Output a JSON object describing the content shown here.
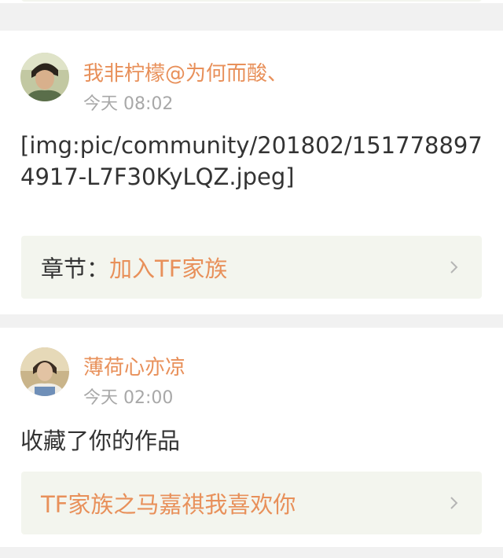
{
  "posts": [
    {
      "username": "我非柠檬@为何而酸、",
      "time": "今天 08:02",
      "content": "[img:pic/community/201802/1517788974917-L7F30KyLQZ.jpeg]",
      "link": {
        "label": "章节：",
        "title": "加入TF家族"
      }
    },
    {
      "username": "薄荷心亦凉",
      "time": "今天 02:00",
      "content": "收藏了你的作品",
      "link": {
        "title": "TF家族之马嘉祺我喜欢你"
      }
    }
  ],
  "icons": {
    "chevron": "chevron-right-icon",
    "avatar1": "avatar-photo-1",
    "avatar2": "avatar-photo-2"
  },
  "colors": {
    "accent": "#e8905a",
    "link_bar_bg": "#f3f5ee",
    "page_bg": "#f1f1f1",
    "time_text": "#a8a8a8",
    "body_text": "#333333"
  }
}
